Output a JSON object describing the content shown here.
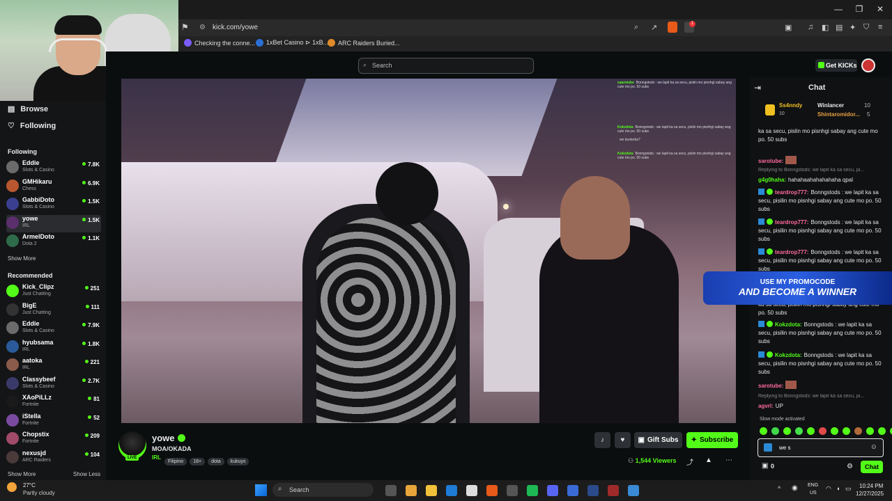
{
  "browser": {
    "url": "kick.com/yowe",
    "bookmarks": [
      {
        "label": "Checking the conne...",
        "color": "#7b5cff"
      },
      {
        "label": "1xBet Casino ⊳ 1xB...",
        "color": "#2a6fd6"
      },
      {
        "label": "ARC Raiders Buried...",
        "color": "#e08a2a"
      }
    ],
    "notification_count": "1"
  },
  "header": {
    "search_placeholder": "Search",
    "get_kicks_label": "Get KICKs"
  },
  "sidebar": {
    "browse_label": "Browse",
    "following_nav_label": "Following",
    "following_heading": "Following",
    "following": [
      {
        "name": "Eddie",
        "category": "Slots & Casino",
        "viewers": "7.8K",
        "color": "#6b6b6b"
      },
      {
        "name": "GMHikaru",
        "category": "Chess",
        "viewers": "6.9K",
        "color": "#b8562f"
      },
      {
        "name": "GabbiDoto",
        "category": "Slots & Casino",
        "viewers": "1.5K",
        "color": "#3b3f8f"
      },
      {
        "name": "yowe",
        "category": "IRL",
        "viewers": "1.5K",
        "color": "#5a2f6b"
      },
      {
        "name": "ArmelDoto",
        "category": "Dota 2",
        "viewers": "1.1K",
        "color": "#2e6b4a"
      }
    ],
    "show_more_following": "Show More",
    "recommended_heading": "Recommended",
    "recommended": [
      {
        "name": "Kick_Clipz",
        "category": "Just Chatting",
        "viewers": "251",
        "color": "#53fc18"
      },
      {
        "name": "BigE",
        "category": "Just Chatting",
        "viewers": "111",
        "color": "#333333"
      },
      {
        "name": "Eddie",
        "category": "Slots & Casino",
        "viewers": "7.9K",
        "color": "#6b6b6b"
      },
      {
        "name": "hyubsama",
        "category": "IRL",
        "viewers": "1.8K",
        "color": "#2a5a9a"
      },
      {
        "name": "aatoka",
        "category": "IRL",
        "viewers": "221",
        "color": "#8a5a4a"
      },
      {
        "name": "Classybeef",
        "category": "Slots & Casino",
        "viewers": "2.7K",
        "color": "#3a3a6a"
      },
      {
        "name": "XAoPiLLz",
        "category": "Fortnite",
        "viewers": "81",
        "color": "#1a1a1a"
      },
      {
        "name": "iStella",
        "category": "Fortnite",
        "viewers": "52",
        "color": "#7a4aa0"
      },
      {
        "name": "Chopstix",
        "category": "Fortnite",
        "viewers": "209",
        "color": "#a04a6a"
      },
      {
        "name": "nexusjd",
        "category": "ARC Raiders",
        "viewers": "104",
        "color": "#4a3a3a"
      }
    ],
    "show_more_recommended": "Show More",
    "show_less": "Show Less"
  },
  "stream": {
    "username": "yowe",
    "live_label": "LIVE",
    "title": "MOA/OKADA",
    "category": "IRL",
    "tags": [
      "Filipino",
      "18+",
      "dota",
      "kukuys"
    ],
    "gift_subs_label": "Gift Subs",
    "subscribe_label": "Subscribe",
    "viewers": "1,544",
    "viewers_label": "Viewers"
  },
  "video_overlay_chat": [
    {
      "user": "saarotube",
      "text": "Bonngstods : we lapit ka sa secu, pislin mo pisnhgi sabay ang cute mo po. 50 subs"
    },
    {
      "user": "Kokzdota",
      "text": "Bonngstods : we lapit ka sa secu, pislin mo pisnhgi sabay ang cute mo po. 50 subs"
    },
    {
      "user": "",
      "text": "we bustorka?"
    },
    {
      "user": "Kokzdota",
      "text": "Bonngstods : we lapit ka sa secu, pislin mo pisnhgi sabay ang cute mo po. 50 subs"
    }
  ],
  "chat": {
    "title": "Chat",
    "leaderboard": [
      {
        "name": "Ss4nndy",
        "value": "10"
      },
      {
        "name": "Winlancer",
        "value": "10"
      },
      {
        "name": "Shintaromidor...",
        "value": "5"
      }
    ],
    "messages": [
      {
        "type": "msg",
        "user": "",
        "text": "ka sa secu, pislin mo pisnhgi sabay ang cute mo po. 50 subs",
        "color": "#53fc18"
      },
      {
        "type": "msg",
        "user": "sarotube:",
        "text": "",
        "color": "#ff6b9a"
      },
      {
        "type": "reply",
        "text": "Replying to Bonngstods: we lapit ka sa secu, pi..."
      },
      {
        "type": "msg",
        "user": "g4g0haha:",
        "text": "hahahaahahahahaha qpal",
        "color": "#53fc18"
      },
      {
        "type": "msg",
        "user": "teardrop777:",
        "text": "Bonngstods : we lapit ka sa secu, pisilin mo pisnhgi sabay ang cute mo po. 50 subs",
        "color": "#ff6b9a"
      },
      {
        "type": "msg",
        "user": "teardrop777:",
        "text": "Bonngstods : we lapit ka sa secu, pisilin mo pisnhgi sabay ang cute mo po. 50 subs",
        "color": "#ff6b9a"
      },
      {
        "type": "msg",
        "user": "teardrop777:",
        "text": "Bonngstods : we lapit ka sa secu, pisilin mo pisnhgi sabay ang cute mo po. 50 subs",
        "color": "#ff6b9a"
      },
      {
        "type": "msg",
        "user": "",
        "text": "ka sa secu, pisilin mo pisnhgi sabay ang cute mo po. 50 subs",
        "color": "#53fc18"
      },
      {
        "type": "msg",
        "user": "Kokzdota:",
        "text": "Bonngstods : we lapit ka sa secu, pisilin mo pisnhgi sabay ang cute mo po. 50 subs",
        "color": "#53fc18"
      },
      {
        "type": "msg",
        "user": "Kokzdota:",
        "text": "Bonngstods : we lapit ka sa secu, pisilin mo pisnhgi sabay ang cute mo po. 50 subs",
        "color": "#53fc18"
      },
      {
        "type": "msg",
        "user": "sarotube:",
        "text": "",
        "color": "#ff6b9a"
      },
      {
        "type": "reply",
        "text": "Replying to Bonngstods: we lapit ka sa secu, pi..."
      },
      {
        "type": "msg",
        "user": "agvrl:",
        "text": "UP",
        "color": "#ff6b9a"
      }
    ],
    "promo_line1": "USE MY PROMOCODE",
    "promo_line2": "AND BECOME A WINNER",
    "slow_mode": "Slow mode activated",
    "input_value": "we s",
    "kicks_count": "0",
    "send_label": "Chat"
  },
  "taskbar": {
    "weather_temp": "27°C",
    "weather_desc": "Partly cloudy",
    "search_label": "Search",
    "lang": "ENG",
    "region": "US",
    "time": "10:24 PM",
    "date": "12/27/2025"
  }
}
